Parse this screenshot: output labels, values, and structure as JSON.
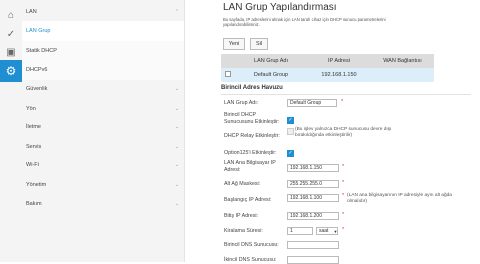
{
  "sidebar": {
    "sections": [
      {
        "label": "LAN",
        "chevron": "^"
      },
      {
        "label": "Güvenlik",
        "chevron": "v"
      },
      {
        "label": "Yön",
        "chevron": "v"
      },
      {
        "label": "İletme",
        "chevron": "v"
      },
      {
        "label": "Servis",
        "chevron": "v"
      },
      {
        "label": "Wi-Fi",
        "chevron": "v"
      },
      {
        "label": "Yönetim",
        "chevron": "v"
      },
      {
        "label": "Bakım",
        "chevron": "v"
      }
    ],
    "subitems": [
      "LAN Grup",
      "Statik DHCP",
      "DHCPv6"
    ],
    "active_subitem": "LAN Grup"
  },
  "icons": [
    "home-icon",
    "status-icon",
    "lock-icon",
    "gear-icon"
  ],
  "page": {
    "title": "LAN Grup Yapılandırması",
    "description": "Bu sayfada, IP adreslerini almak için LAN tarafı cihaz için DHCP sunucu parametrelerini yapılandırabilirsiniz."
  },
  "toolbar": {
    "new_label": "Yeni",
    "delete_label": "Sil"
  },
  "table": {
    "headers": [
      "",
      "LAN Grup Adı",
      "IP Adresi",
      "WAN Bağlantısı"
    ],
    "rows": [
      {
        "name": "Default Group",
        "ip": "192.168.1.150",
        "wan": ""
      }
    ]
  },
  "form": {
    "section_title": "Birincil Adres Havuzu",
    "group_name_label": "LAN Grup Adı:",
    "group_name_value": "Default Group",
    "dhcp_enable_label": "Birincil DHCP Sunucusunu Etkinleştir:",
    "dhcp_relay_label": "DHCP Relay Etkinleştir:",
    "dhcp_relay_note": "(Bu işlev yalnızca DHCP sunucusu devre dışı bırakıldığında etkinleştirilir)",
    "option125_label": "Option125'i Etkinleştir:",
    "lan_ip_label": "LAN Ana Bilgisayar IP Adresi:",
    "lan_ip_value": "192.168.1.150",
    "subnet_label": "Alt Ağ Maskesi:",
    "subnet_value": "255.255.255.0",
    "start_ip_label": "Başlangıç IP Adresi:",
    "start_ip_value": "192.168.1.100",
    "start_ip_note": "(LAN ana bilgisayarının IP adresiyle aynı alt ağda olmalıdır)",
    "end_ip_label": "Bitiş IP Adresi:",
    "end_ip_value": "192.168.1.200",
    "lease_label": "Kiralama Süresi:",
    "lease_value": "1",
    "lease_unit": "saat",
    "dns1_label": "Birincil DNS Sunucusu:",
    "dns1_value": "",
    "dns2_label": "İkincil DNS Sunucusu:",
    "dns2_value": "",
    "required_mark": "*"
  },
  "colors": {
    "accent": "#1f8fd2",
    "selected_row": "#dceefa",
    "required": "#e0342b"
  }
}
